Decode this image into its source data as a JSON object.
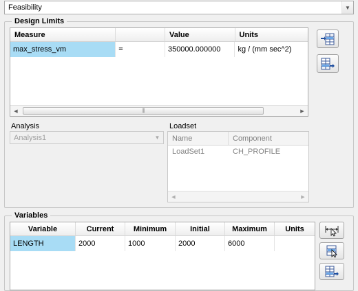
{
  "top_dropdown": {
    "value": "Feasibility"
  },
  "design_limits": {
    "title": "Design Limits",
    "columns": [
      "Measure",
      "",
      "Value",
      "Units"
    ],
    "rows": [
      {
        "measure": "max_stress_vm",
        "op": "=",
        "value": "350000.000000",
        "units": "kg / (mm sec^2)"
      }
    ]
  },
  "analysis": {
    "label": "Analysis",
    "value": "Analysis1"
  },
  "loadset": {
    "label": "Loadset",
    "columns": [
      "Name",
      "Component"
    ],
    "rows": [
      {
        "name": "LoadSet1",
        "component": "CH_PROFILE"
      }
    ]
  },
  "variables": {
    "title": "Variables",
    "columns": [
      "Variable",
      "Current",
      "Minimum",
      "Initial",
      "Maximum",
      "Units"
    ],
    "rows": [
      {
        "variable": "LENGTH",
        "current": "2000",
        "minimum": "1000",
        "initial": "2000",
        "maximum": "6000",
        "units": ""
      }
    ]
  },
  "icons": {
    "insert_before": "table-insert-icon",
    "insert_after": "table-append-icon",
    "select_dimension": "select-dimension-icon",
    "select_parameter": "select-parameter-icon"
  },
  "colors": {
    "selection": "#a8dcf5",
    "border": "#a9a9a9",
    "background": "#f0f0f0"
  }
}
